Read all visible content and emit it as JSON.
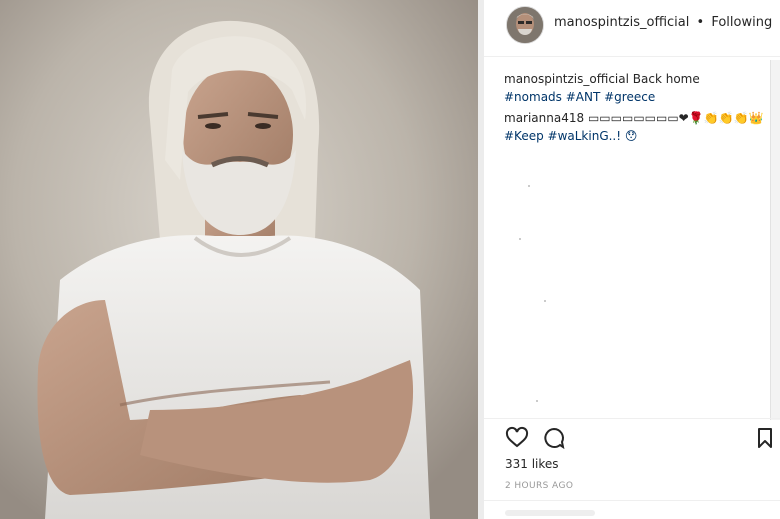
{
  "post": {
    "image_alt": "portrait photo of a man with long white hair and beard, arms crossed, white t-shirt"
  },
  "header": {
    "username": "manospintzis_official",
    "separator": "•",
    "follow_status": "Following"
  },
  "comments": [
    {
      "user": "manospintzis_official",
      "text": "Back home",
      "tags": "#nomads #ANT #greece"
    },
    {
      "user": "marianna418",
      "text": "▭▭▭▭▭▭▭▭❤🌹👏👏👏👑",
      "tags": "#Keep #waLkinG..! 😯"
    }
  ],
  "actions": {
    "like_icon": "heart-icon",
    "comment_icon": "comment-icon",
    "save_icon": "bookmark-icon"
  },
  "stats": {
    "likes": "331 likes",
    "timestamp": "2 HOURS AGO"
  },
  "colors": {
    "hashtag": "#003569",
    "text": "#262626",
    "muted": "#999999"
  }
}
